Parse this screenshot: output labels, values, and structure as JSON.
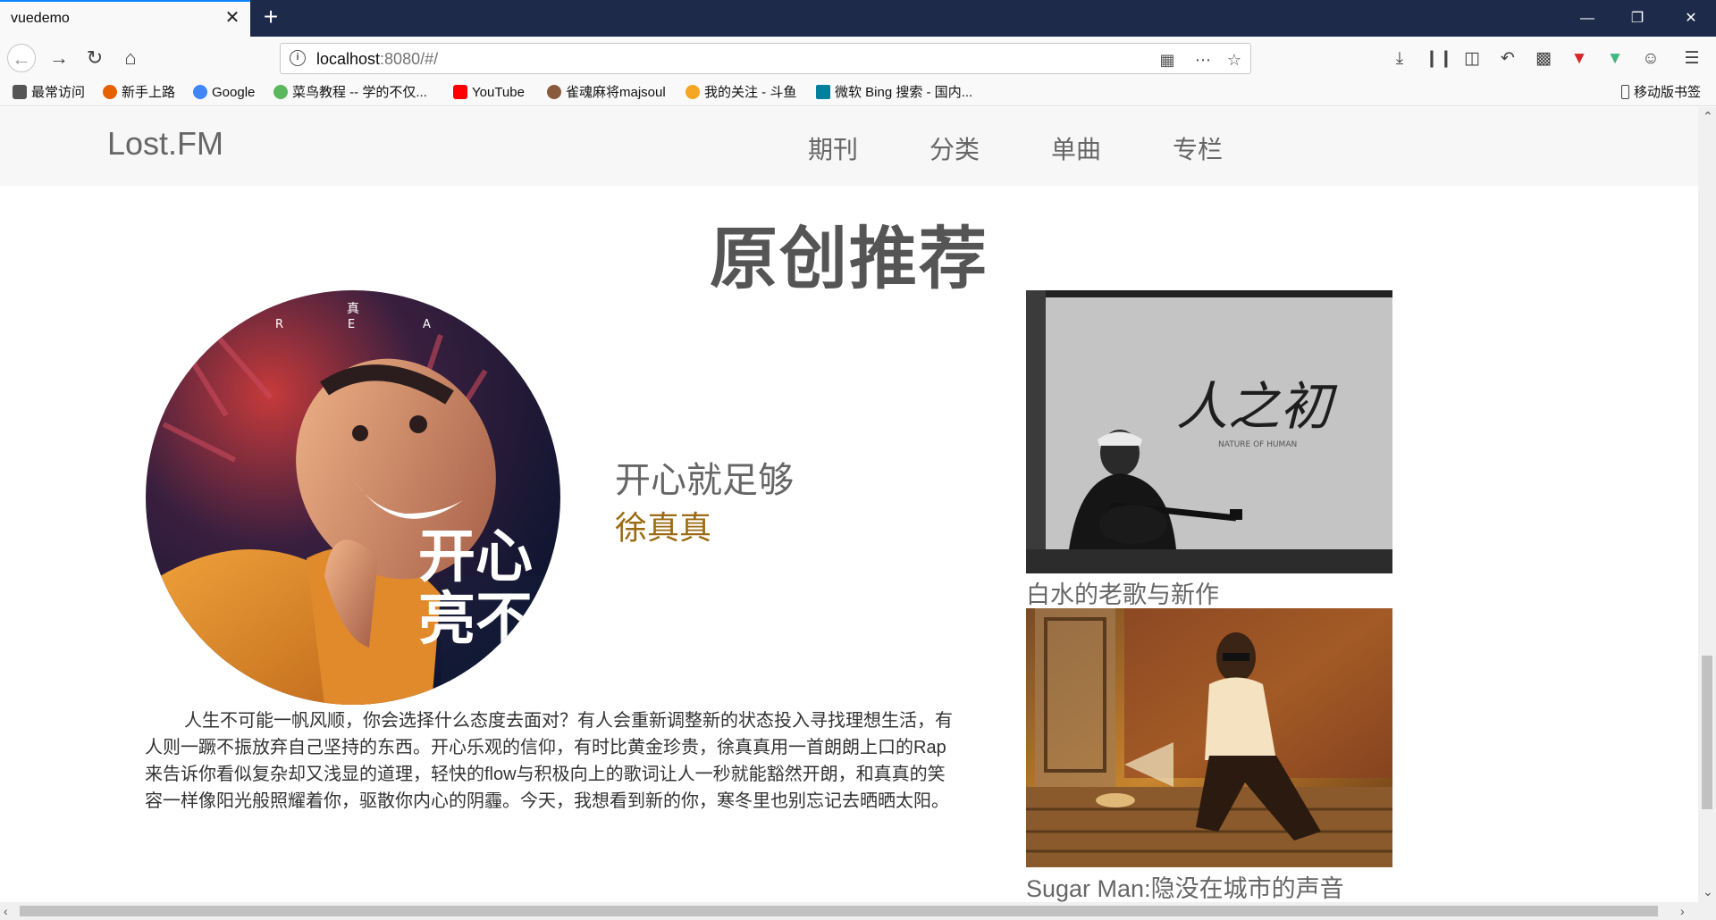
{
  "browser": {
    "tab_title": "vuedemo",
    "tab_close": "✕",
    "new_tab": "+",
    "url_host": "localhost",
    "url_rest": ":8080/#/",
    "bookmarks": [
      {
        "label": "最常访问",
        "color": "#555555"
      },
      {
        "label": "新手上路",
        "color": "#e66000"
      },
      {
        "label": "Google",
        "color": "#4285f4"
      },
      {
        "label": "菜鸟教程 -- 学的不仅...",
        "color": "#5cb85c"
      },
      {
        "label": "YouTube",
        "color": "#ff0000"
      },
      {
        "label": "雀魂麻将majsoul",
        "color": "#8a5a3c"
      },
      {
        "label": "我的关注 - 斗鱼",
        "color": "#f5a623"
      },
      {
        "label": "微软 Bing 搜索 - 国内...",
        "color": "#00809d"
      }
    ],
    "mobile_bookmarks": "移动版书签"
  },
  "site": {
    "brand": "Lost.FM",
    "menu": [
      "期刊",
      "分类",
      "单曲",
      "专栏"
    ]
  },
  "section": {
    "title": "原创推荐"
  },
  "feature": {
    "song_title": "开心就足够",
    "artist": "徐真真",
    "description": "人生不可能一帆风顺，你会选择什么态度去面对？有人会重新调整新的状态投入寻找理想生活，有人则一蹶不振放弃自己坚持的东西。开心乐观的信仰，有时比黄金珍贵，徐真真用一首朗朗上口的Rap来告诉你看似复杂却又浅显的道理，轻快的flow与积极向上的歌词让人一秒就能豁然开朗，和真真的笑容一样像阳光般照耀着你，驱散你内心的阴霾。今天，我想看到新的你，寒冬里也别忘记去晒晒太阳。",
    "cover_text_top": "真",
    "cover_letters": [
      "R",
      "E",
      "A"
    ],
    "cover_big_text": "开心",
    "cover_big_text2": "亮不"
  },
  "side_items": [
    {
      "caption": "白水的老歌与新作",
      "image_text": "人之初",
      "image_subtext": "NATURE OF HUMAN"
    },
    {
      "caption": "Sugar Man:隐没在城市的声音"
    }
  ],
  "colors": {
    "accent_tab": "#0a84ff",
    "titlebar": "#1d2a4a",
    "artist": "#9b6a12"
  }
}
